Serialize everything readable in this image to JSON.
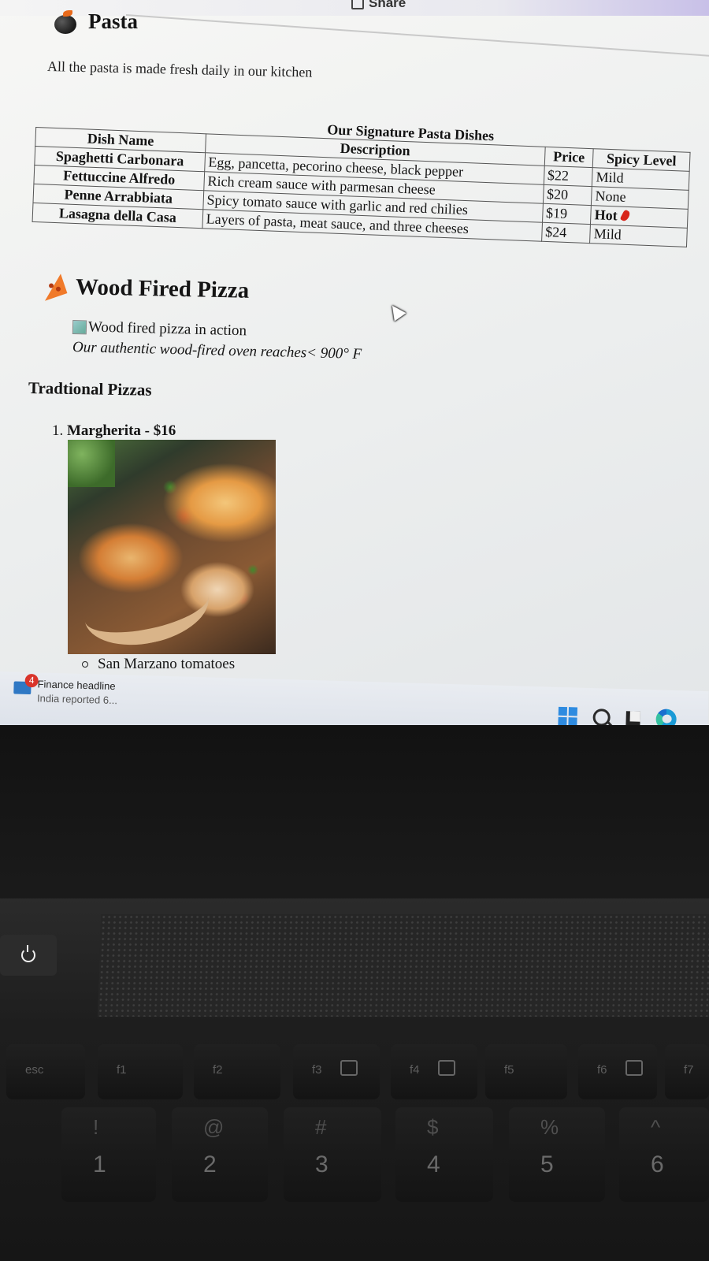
{
  "browser": {
    "share_label": "Share"
  },
  "pasta": {
    "heading": "Pasta",
    "intro": "All the pasta is made fresh daily in our kitchen",
    "table": {
      "caption": "Our Signature Pasta Dishes",
      "headers": [
        "Dish Name",
        "Description",
        "Price",
        "Spicy Level"
      ],
      "rows": [
        {
          "name": "Spaghetti Carbonara",
          "description": "Egg, pancetta, pecorino cheese, black pepper",
          "price": "$22",
          "spicy": "Mild"
        },
        {
          "name": "Fettuccine Alfredo",
          "description": "Rich cream sauce with parmesan cheese",
          "price": "$20",
          "spicy": "None"
        },
        {
          "name": "Penne Arrabbiata",
          "description": "Spicy tomato sauce with garlic and red chilies",
          "price": "$19",
          "spicy": "Hot"
        },
        {
          "name": "Lasagna della Casa",
          "description": "Layers of pasta, meat sauce, and three cheeses",
          "price": "$24",
          "spicy": "Mild"
        }
      ]
    }
  },
  "pizza": {
    "heading": "Wood Fired Pizza",
    "image_alt": "Wood fired pizza in action",
    "caption": "Our authentic wood-fired oven reaches< 900° F",
    "traditional_heading": "Tradtional Pizzas",
    "items": [
      {
        "number": "1.",
        "label": "Margherita - $16",
        "toppings": [
          "San Marzano tomatoes"
        ]
      }
    ]
  },
  "taskbar": {
    "news_badge": "4",
    "news_title": "Finance headline",
    "news_subtitle": "India reported 6..."
  },
  "keyboard": {
    "fkeys": [
      "esc",
      "f1",
      "f2",
      "f3",
      "f4",
      "f5",
      "f6",
      "f7"
    ],
    "numkeys": [
      {
        "top": "!",
        "bottom": "1"
      },
      {
        "top": "@",
        "bottom": "2"
      },
      {
        "top": "#",
        "bottom": "3"
      },
      {
        "top": "$",
        "bottom": "4"
      },
      {
        "top": "%",
        "bottom": "5"
      },
      {
        "top": "^",
        "bottom": "6"
      }
    ]
  },
  "colors": {
    "accent": "#2e8be0",
    "chili": "#d8261b",
    "news_badge": "#d9342b"
  }
}
